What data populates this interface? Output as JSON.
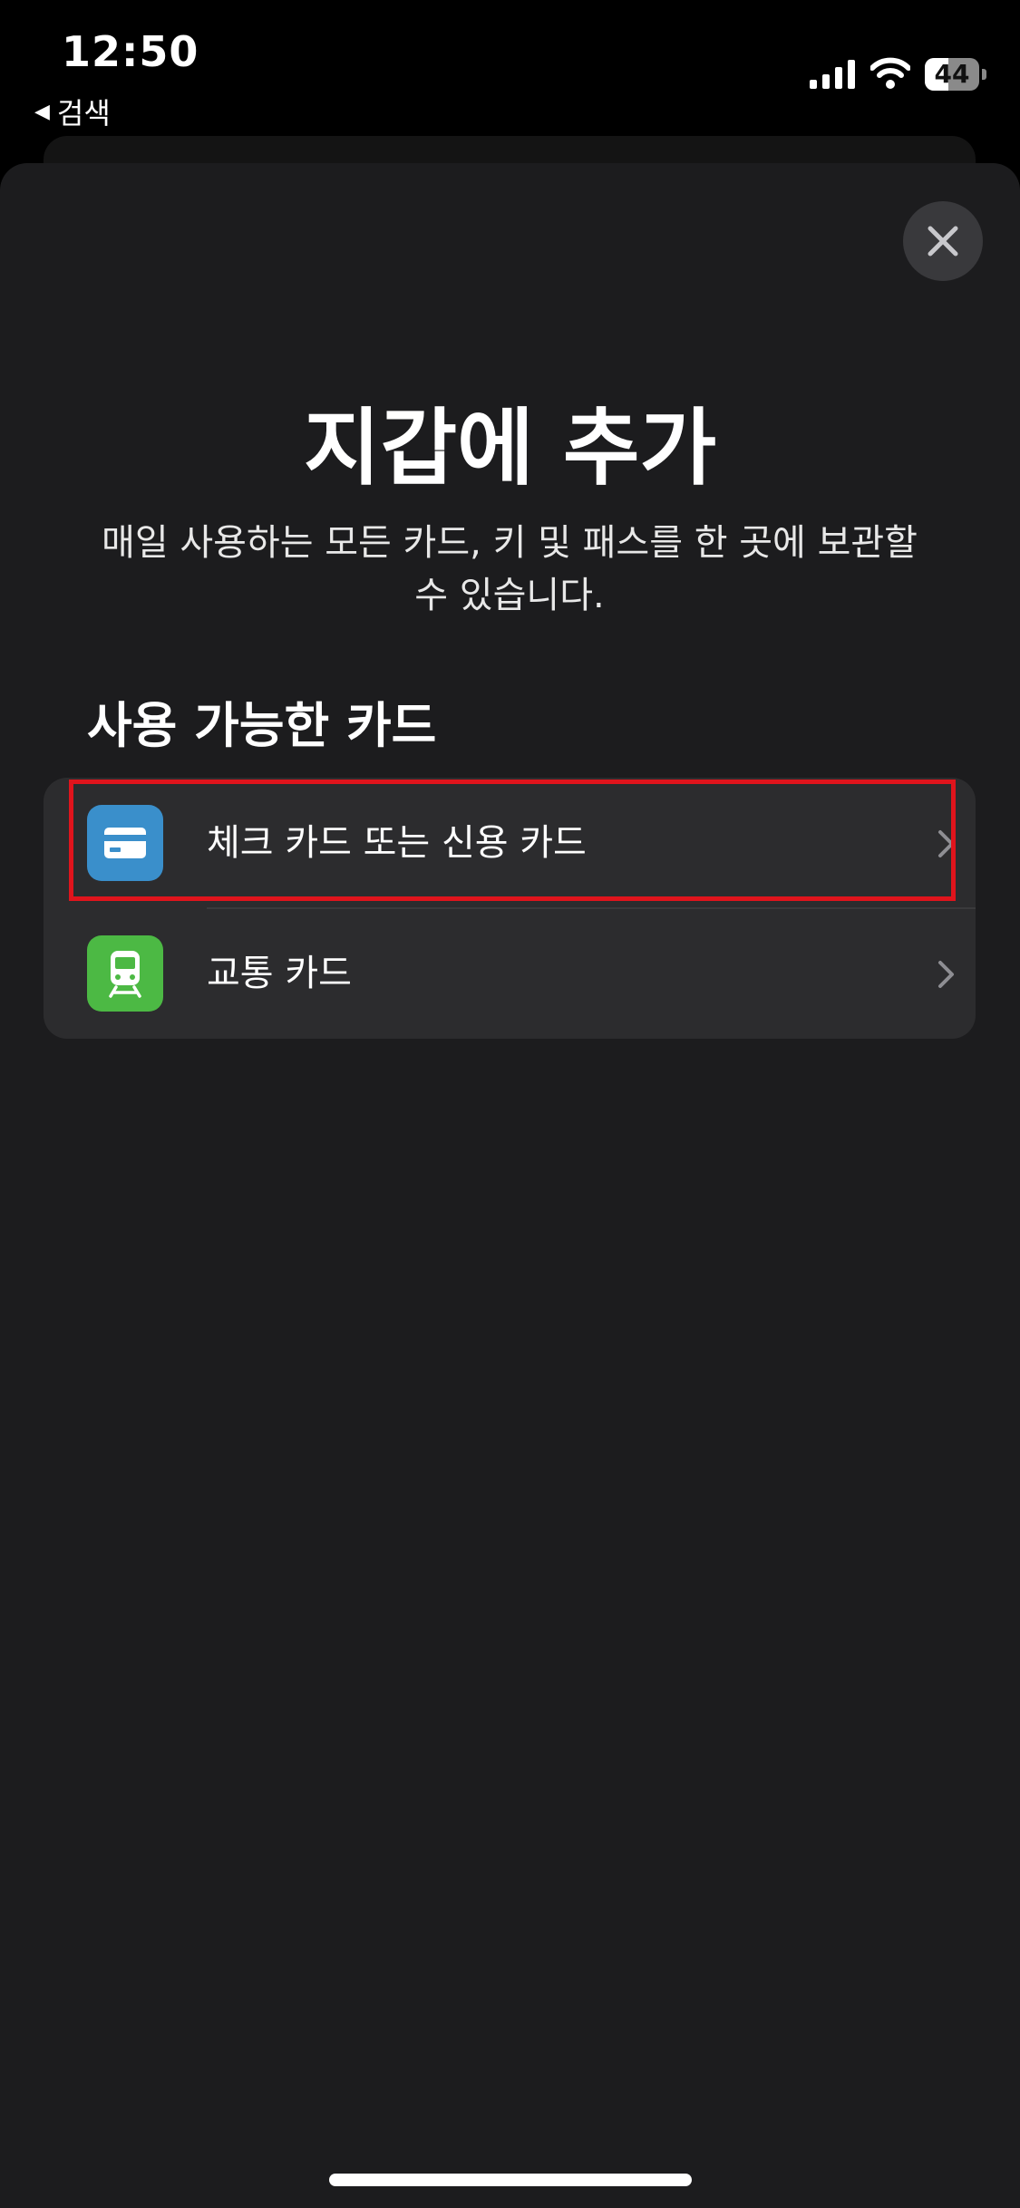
{
  "status_bar": {
    "time": "12:50",
    "back_label": "검색",
    "battery_level": "44"
  },
  "sheet": {
    "title": "지갑에 추가",
    "description": "매일 사용하는 모든 카드, 키 및 패스를 한 곳에 보관할 수 있습니다.",
    "section_title": "사용 가능한 카드",
    "options": [
      {
        "label": "체크 카드 또는 신용 카드",
        "icon": "credit-card-icon",
        "icon_bg": "#3a8fcb"
      },
      {
        "label": "교통 카드",
        "icon": "train-icon",
        "icon_bg": "#4cb944"
      }
    ]
  },
  "colors": {
    "background": "#1c1c1e",
    "list_background": "#2c2c2e",
    "highlight": "#e0141c"
  }
}
